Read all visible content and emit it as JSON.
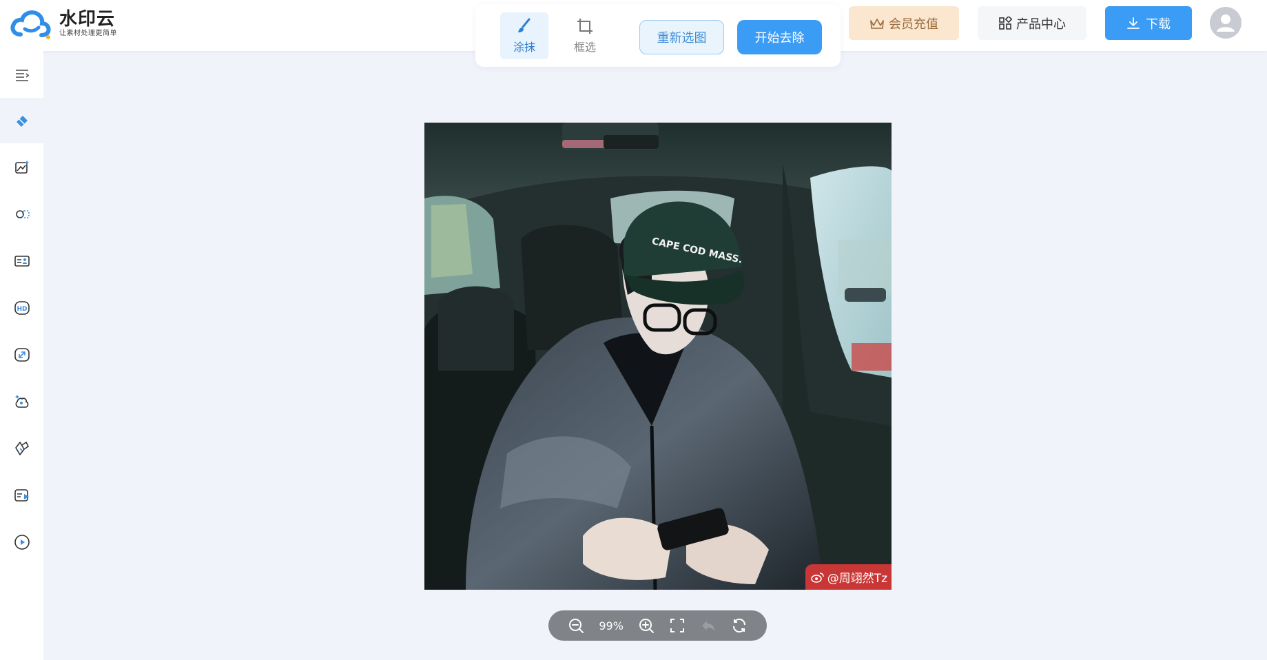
{
  "header": {
    "logo_name": "水印云",
    "logo_slogan": "让素材处理更简单",
    "tools": {
      "smear_label": "涂抹",
      "box_label": "框选"
    },
    "reselect_label": "重新选图",
    "start_label": "开始去除",
    "vip_label": "会员充值",
    "products_label": "产品中心",
    "download_label": "下载"
  },
  "sidebar": {
    "items": [
      {
        "icon": "menu-collapse-icon"
      },
      {
        "icon": "eraser-icon"
      },
      {
        "icon": "image-edit-icon"
      },
      {
        "icon": "cutout-icon"
      },
      {
        "icon": "id-photo-icon"
      },
      {
        "icon": "hd-icon"
      },
      {
        "icon": "resize-icon"
      },
      {
        "icon": "ai-magic-icon"
      },
      {
        "icon": "link-icon"
      },
      {
        "icon": "video-text-icon"
      },
      {
        "icon": "play-icon"
      }
    ]
  },
  "canvas": {
    "cap_text": "CAPE COD MASS.",
    "watermark_text": "@周翊然Tz"
  },
  "zoombar": {
    "zoom_value": "99%"
  },
  "colors": {
    "accent": "#3a9cf5",
    "vip_bg": "#fbe6cf",
    "page_bg": "#f0f4fa"
  }
}
